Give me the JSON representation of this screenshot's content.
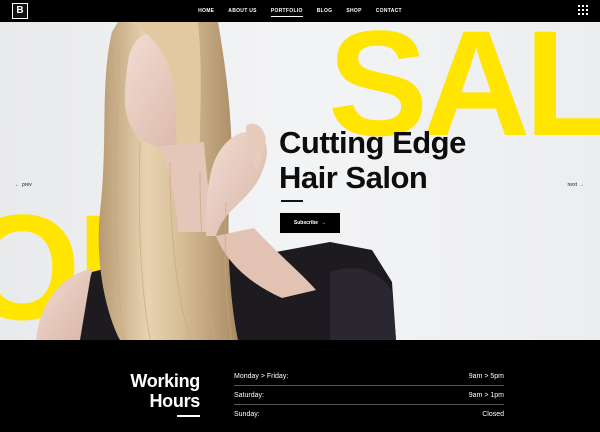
{
  "header": {
    "logo_letter": "B",
    "nav": [
      "HOME",
      "ABOUT US",
      "PORTFOLIO",
      "BLOG",
      "SHOP",
      "CONTACT"
    ],
    "active_nav": "PORTFOLIO"
  },
  "hero": {
    "bg_word_right": "SAL",
    "bg_word_left": "ON",
    "headline_line1": "Cutting Edge",
    "headline_line2": "Hair Salon",
    "subscribe_label": "Subscribe",
    "prev_label": "prev",
    "next_label": "next",
    "accent_color": "#ffe500"
  },
  "hours": {
    "title_line1": "Working",
    "title_line2": "Hours",
    "rows": [
      {
        "day": "Monday > Friday:",
        "time": "9am > 5pm"
      },
      {
        "day": "Saturday:",
        "time": "9am > 1pm"
      },
      {
        "day": "Sunday:",
        "time": "Closed"
      }
    ]
  }
}
